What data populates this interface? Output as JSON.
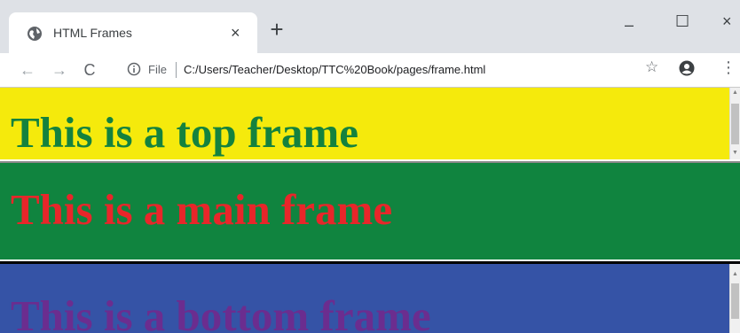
{
  "tab": {
    "title": "HTML Frames",
    "close": "×",
    "new_tab": "+"
  },
  "window_controls": {
    "minimize": "–",
    "maximize": "☐",
    "close": "×"
  },
  "toolbar": {
    "back": "←",
    "forward": "→",
    "reload": "C",
    "scheme_label": "File",
    "url": "C:/Users/Teacher/Desktop/TTC%20Book/pages/frame.html",
    "bookmark": "☆",
    "menu": "⋮"
  },
  "frames": {
    "top": {
      "text": "This is a top frame",
      "bg": "#f5ea0c",
      "color": "#14823e"
    },
    "main": {
      "text": "This is a main frame",
      "bg": "#10843f",
      "color": "#e8262a"
    },
    "bottom": {
      "text": "This is a bottom frame",
      "bg": "#3553a6",
      "color": "#6b2d8f"
    }
  },
  "icons": [
    "globe-icon",
    "info-icon",
    "account-icon"
  ]
}
